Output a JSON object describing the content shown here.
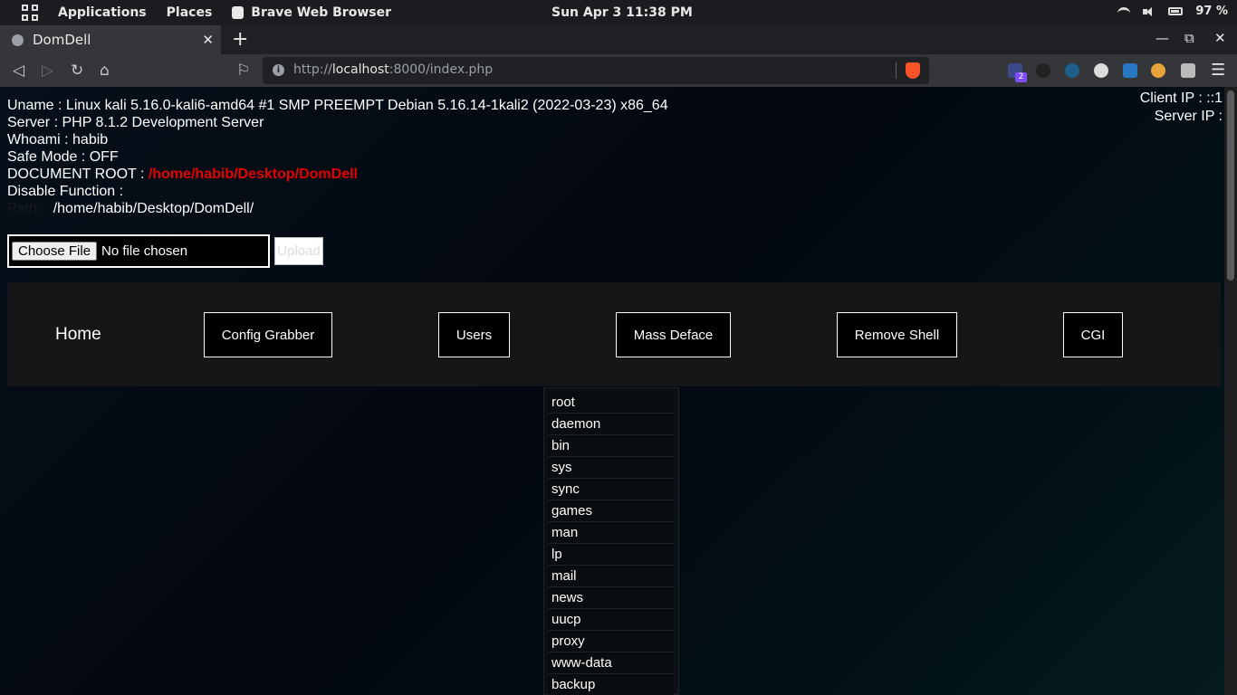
{
  "panel": {
    "applications": "Applications",
    "places": "Places",
    "active_app": "Brave Web Browser",
    "clock": "Sun Apr 3  11:38 PM",
    "battery": "97 %"
  },
  "browser": {
    "tab_title": "DomDell",
    "tab_close": "✕",
    "new_tab": "+",
    "url_prefix": "http://",
    "url_host": "localhost",
    "url_rest": ":8000/index.php",
    "ext_badge": "2",
    "win_min": "—",
    "win_max": "⧉",
    "win_close": "✕"
  },
  "info": {
    "uname_label": "Uname : ",
    "uname": "Linux kali 5.16.0-kali6-amd64 #1 SMP PREEMPT Debian 5.16.14-1kali2 (2022-03-23) x86_64",
    "server_label": "Server : ",
    "server": "PHP 8.1.2 Development Server",
    "whoami_label": "Whoami : ",
    "whoami": "habib",
    "safemode_label": "Safe Mode : ",
    "safemode": "OFF",
    "docroot_label": "DOCUMENT ROOT : ",
    "docroot": "/home/habib/Desktop/DomDell",
    "disable_label": "Disable Function :",
    "path_label": "Path :",
    "path": "/home/habib/Desktop/DomDell/",
    "client_ip": "Client IP : ::1",
    "server_ip": "Server IP :"
  },
  "upload": {
    "choose": "Choose File",
    "nofile": "No file chosen",
    "button": "Upload"
  },
  "nav": {
    "home": "Home",
    "config": "Config Grabber",
    "users": "Users",
    "deface": "Mass Deface",
    "remove": "Remove Shell",
    "cgi": "CGI"
  },
  "users": [
    "root",
    "daemon",
    "bin",
    "sys",
    "sync",
    "games",
    "man",
    "lp",
    "mail",
    "news",
    "uucp",
    "proxy",
    "www-data",
    "backup"
  ]
}
